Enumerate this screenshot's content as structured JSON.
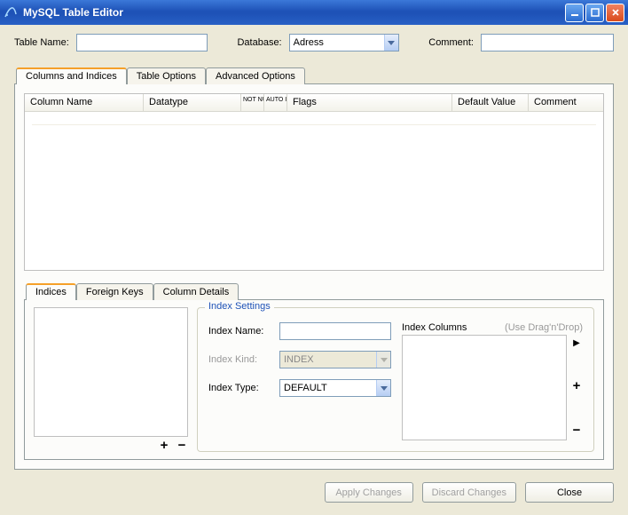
{
  "window": {
    "title": "MySQL Table Editor"
  },
  "topForm": {
    "tableNameLabel": "Table Name:",
    "tableNameValue": "",
    "databaseLabel": "Database:",
    "databaseValue": "Adress",
    "commentLabel": "Comment:",
    "commentValue": ""
  },
  "mainTabs": [
    {
      "label": "Columns and Indices",
      "active": true
    },
    {
      "label": "Table Options",
      "active": false
    },
    {
      "label": "Advanced Options",
      "active": false
    }
  ],
  "gridColumns": {
    "columnName": "Column Name",
    "datatype": "Datatype",
    "notNull": "NOT\nNULL",
    "autoInc": "AUTO\nINC",
    "flags": "Flags",
    "defaultValue": "Default Value",
    "comment": "Comment"
  },
  "subTabs": [
    {
      "label": "Indices",
      "active": true
    },
    {
      "label": "Foreign Keys",
      "active": false
    },
    {
      "label": "Column Details",
      "active": false
    }
  ],
  "indexSettings": {
    "legend": "Index Settings",
    "indexNameLabel": "Index Name:",
    "indexNameValue": "",
    "indexKindLabel": "Index Kind:",
    "indexKindValue": "INDEX",
    "indexTypeLabel": "Index Type:",
    "indexTypeValue": "DEFAULT",
    "indexColumnsLabel": "Index Columns",
    "dragHint": "(Use Drag'n'Drop)"
  },
  "footer": {
    "apply": "Apply Changes",
    "discard": "Discard Changes",
    "close": "Close"
  },
  "icons": {
    "plus": "+",
    "minus": "−",
    "play": "▶"
  }
}
